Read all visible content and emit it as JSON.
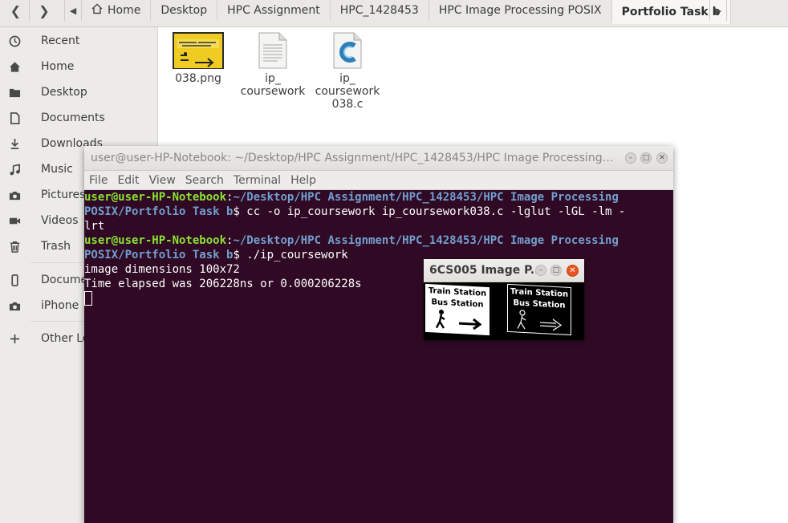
{
  "breadcrumbs": {
    "items": [
      "Home",
      "Desktop",
      "HPC Assignment",
      "HPC_1428453",
      "HPC Image Processing POSIX",
      "Portfolio Task b"
    ]
  },
  "sidebar": {
    "items": [
      {
        "label": "Recent",
        "icon": "clock-icon"
      },
      {
        "label": "Home",
        "icon": "home-icon"
      },
      {
        "label": "Desktop",
        "icon": "folder-icon"
      },
      {
        "label": "Documents",
        "icon": "document-icon"
      },
      {
        "label": "Downloads",
        "icon": "download-icon"
      },
      {
        "label": "Music",
        "icon": "music-icon"
      },
      {
        "label": "Pictures",
        "icon": "camera-icon"
      },
      {
        "label": "Videos",
        "icon": "video-icon"
      },
      {
        "label": "Trash",
        "icon": "trash-icon"
      },
      {
        "label": "Docume",
        "icon": "phone-icon"
      },
      {
        "label": "iPhone",
        "icon": "camera-icon"
      },
      {
        "label": "Other Lo",
        "icon": "plus-icon"
      }
    ]
  },
  "files": [
    {
      "name": "038.png",
      "type": "image"
    },
    {
      "name_line1": "ip_",
      "name_line2": "coursework",
      "type": "executable"
    },
    {
      "name_line1": "ip_",
      "name_line2": "coursework",
      "name_line3": "038.c",
      "type": "c-source"
    }
  ],
  "terminal": {
    "title": "user@user-HP-Notebook: ~/Desktop/HPC Assignment/HPC_1428453/HPC Image Processing…",
    "menu": [
      "File",
      "Edit",
      "View",
      "Search",
      "Terminal",
      "Help"
    ],
    "lines": {
      "l1_user": "user@user-HP-Notebook",
      "l1_colon": ":",
      "l1_path": "~/Desktop/HPC Assignment/HPC_1428453/HPC Image Processing",
      "l2_path": "POSIX/Portfolio Task b",
      "l2_cmd": "$ cc -o ip_coursework ip_coursework038.c -lglut -lGL -lm -",
      "l3_cmd": "lrt",
      "l4_user": "user@user-HP-Notebook",
      "l4_colon": ":",
      "l4_path": "~/Desktop/HPC Assignment/HPC_1428453/HPC Image Processing",
      "l5_path": "POSIX/Portfolio Task b",
      "l5_cmd": "$ ./ip_coursework",
      "l6": "image dimensions 100x72",
      "l7": "Time elapsed was 206228ns or 0.000206228s"
    }
  },
  "image_window": {
    "title": "6CS005 Image P...",
    "sign_line1": "Train Station",
    "sign_line2": "Bus Station"
  },
  "colors": {
    "terminal_bg": "#300a24",
    "prompt_user": "#8ae234",
    "prompt_path": "#729fcf",
    "close_button": "#e95420"
  }
}
